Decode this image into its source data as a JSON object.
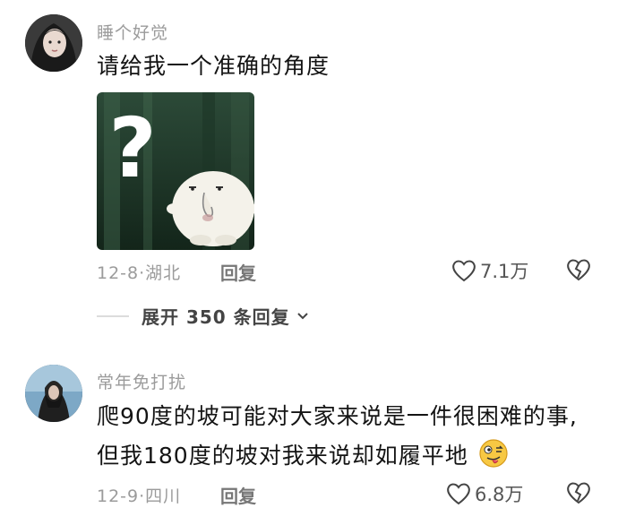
{
  "comments": [
    {
      "username": "睡个好觉",
      "text_lines": [
        "请给我一个准确的角度"
      ],
      "date": "12-8",
      "location": "湖北",
      "reply_label": "回复",
      "likes": "7.1万",
      "expand_replies": "展开 350 条回复"
    },
    {
      "username": "常年免打扰",
      "text_lines": [
        "爬90度的坡可能对大家来说是一件很困难的事,",
        "但我180度的坡对我来说却如履平地"
      ],
      "date": "12-9",
      "location": "四川",
      "reply_label": "回复",
      "likes": "6.8万"
    }
  ],
  "sticker": {
    "symbol": "?"
  },
  "colors": {
    "meta": "#9b9b9b",
    "text": "#141414"
  }
}
